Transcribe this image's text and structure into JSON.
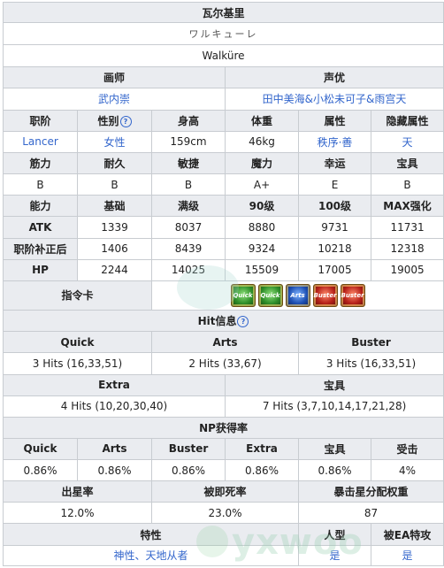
{
  "name": "瓦尔基里",
  "name_jp": "ワルキューレ",
  "name_en": "Walküre",
  "headers": {
    "illustrator": "画师",
    "voice": "声优"
  },
  "illustrator": "武内崇",
  "voice_actors": "田中美海&小松未可子&雨宫天",
  "attr_headers": [
    "职阶",
    "性别",
    "身高",
    "体重",
    "属性",
    "隐藏属性"
  ],
  "attr_values": [
    "Lancer",
    "女性",
    "159cm",
    "46kg",
    "秩序·善",
    "天"
  ],
  "stat_headers": [
    "筋力",
    "耐久",
    "敏捷",
    "魔力",
    "幸运",
    "宝具"
  ],
  "stat_values": [
    "B",
    "B",
    "B",
    "A+",
    "E",
    "B"
  ],
  "ability_headers": [
    "能力",
    "基础",
    "满级",
    "90级",
    "100级",
    "MAX强化"
  ],
  "atk_row": {
    "label": "ATK",
    "values": [
      "1339",
      "8037",
      "8880",
      "9731",
      "11731"
    ]
  },
  "atk_fix_row": {
    "label": "职阶补正后",
    "values": [
      "1406",
      "8439",
      "9324",
      "10218",
      "12318"
    ]
  },
  "hp_row": {
    "label": "HP",
    "values": [
      "2244",
      "14025",
      "15509",
      "17005",
      "19005"
    ]
  },
  "command_cards": {
    "label": "指令卡",
    "cards": [
      {
        "type": "quick",
        "text": "Quick"
      },
      {
        "type": "quick",
        "text": "Quick"
      },
      {
        "type": "arts",
        "text": "Arts"
      },
      {
        "type": "buster",
        "text": "Buster"
      },
      {
        "type": "buster",
        "text": "Buster"
      }
    ]
  },
  "hit_info": {
    "title": "Hit信息",
    "headers": [
      "Quick",
      "Arts",
      "Buster"
    ],
    "values": [
      "3 Hits (16,33,51)",
      "2 Hits (33,67)",
      "3 Hits (16,33,51)"
    ],
    "headers2": [
      "Extra",
      "宝具"
    ],
    "values2": [
      "4 Hits (10,20,30,40)",
      "7 Hits (3,7,10,14,17,21,28)"
    ]
  },
  "np_rate": {
    "title": "NP获得率",
    "headers": [
      "Quick",
      "Arts",
      "Buster",
      "Extra",
      "宝具",
      "受击"
    ],
    "values": [
      "0.86%",
      "0.86%",
      "0.86%",
      "0.86%",
      "0.86%",
      "4%"
    ]
  },
  "star": {
    "headers": [
      "出星率",
      "被即死率",
      "暴击星分配权重"
    ],
    "values": [
      "12.0%",
      "23.0%",
      "87"
    ]
  },
  "traits": {
    "headers": [
      "特性",
      "人型",
      "被EA特攻"
    ],
    "traits_value": "神性、天地从者",
    "humanoid": "是",
    "ea": "是"
  },
  "watermark": "yxwoo"
}
